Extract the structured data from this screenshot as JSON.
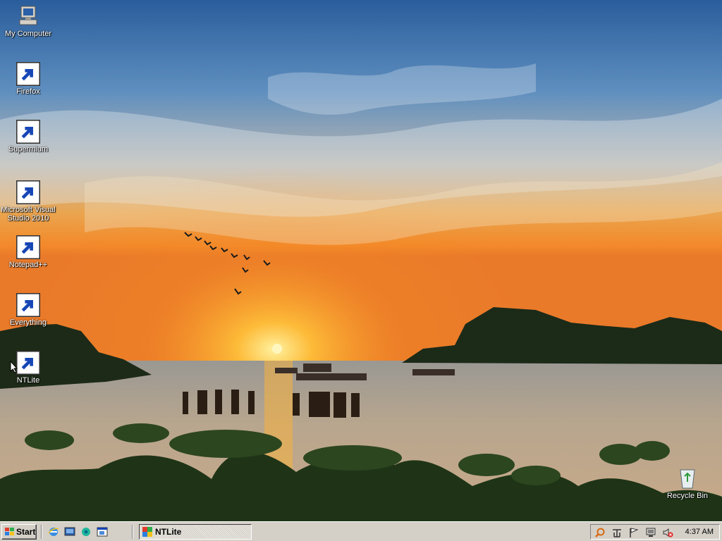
{
  "desktop": {
    "icons": [
      {
        "label": "My Computer",
        "icon": "my-computer-icon"
      },
      {
        "label": "Firefox",
        "icon": "firefox-icon"
      },
      {
        "label": "Supermium",
        "icon": "supermium-icon"
      },
      {
        "label": "Microsoft Visual Studio 2010",
        "icon": "visual-studio-icon"
      },
      {
        "label": "Notepad++",
        "icon": "notepad-plus-plus-icon"
      },
      {
        "label": "Everything",
        "icon": "everything-icon"
      },
      {
        "label": "NTLite",
        "icon": "ntlite-icon"
      },
      {
        "label": "Recycle Bin",
        "icon": "recycle-bin-icon"
      }
    ],
    "wallpaper": "sunset-over-bay"
  },
  "taskbar": {
    "start_label": "Start",
    "quick_launch": [
      "internet-explorer-icon",
      "show-desktop-icon",
      "supermium-icon",
      "window-switcher-icon"
    ],
    "tasks": [
      {
        "label": "NTLite",
        "icon": "ntlite-icon",
        "active": true
      }
    ],
    "tray": [
      "search-icon",
      "network-icon",
      "flag-icon",
      "monitor-icon",
      "volume-muted-icon"
    ],
    "clock": "4:37 AM"
  },
  "colors": {
    "taskbar": "#d4d0c8",
    "sky_top": "#2a5d9c",
    "sun": "#ffcc22"
  }
}
